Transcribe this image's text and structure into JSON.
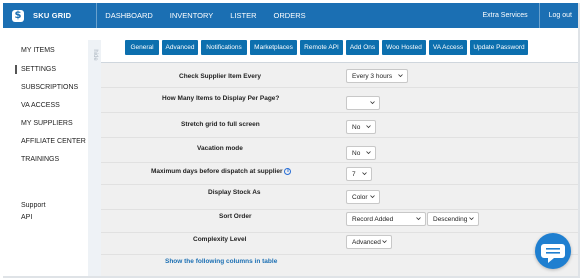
{
  "header": {
    "brand": "SKU GRID",
    "nav": [
      "DASHBOARD",
      "INVENTORY",
      "LISTER",
      "ORDERS"
    ],
    "extra_services": "Extra Services",
    "logout": "Log out"
  },
  "sidebar": {
    "items": [
      "MY ITEMS",
      "SETTINGS",
      "SUBSCRIPTIONS",
      "VA ACCESS",
      "MY SUPPLIERS",
      "AFFILIATE CENTER",
      "TRAININGS"
    ],
    "active": "SETTINGS",
    "footer": [
      "Support",
      "API"
    ],
    "hide_label": "hide"
  },
  "tabs": [
    "General",
    "Advanced",
    "Notifications",
    "Marketplaces",
    "Remote API",
    "Add Ons",
    "Woo Hosted",
    "VA Access",
    "Update Password"
  ],
  "settings": {
    "check_supplier": {
      "label": "Check Supplier Item Every",
      "value": "Every 3 hours"
    },
    "items_per_page": {
      "label": "How Many Items to Display Per Page?",
      "value": ""
    },
    "stretch_grid": {
      "label": "Stretch grid to full screen",
      "value": "No"
    },
    "vacation_mode": {
      "label": "Vacation mode",
      "value": "No"
    },
    "max_dispatch": {
      "label": "Maximum days before dispatch at supplier",
      "value": "7"
    },
    "display_stock": {
      "label": "Display Stock As",
      "value": "Color"
    },
    "sort_order": {
      "label": "Sort Order",
      "value": "Record Added",
      "direction": "Descending"
    },
    "complexity": {
      "label": "Complexity Level",
      "value": "Advanced"
    },
    "columns_link": "Show the following columns in table"
  },
  "colors": {
    "primary": "#1b6fb3",
    "tab": "#0c6fae",
    "content_bg": "#f0f0f0"
  },
  "icons": [
    "logo-dollar-icon",
    "info-icon",
    "chevron-down-icon",
    "chat-icon"
  ]
}
